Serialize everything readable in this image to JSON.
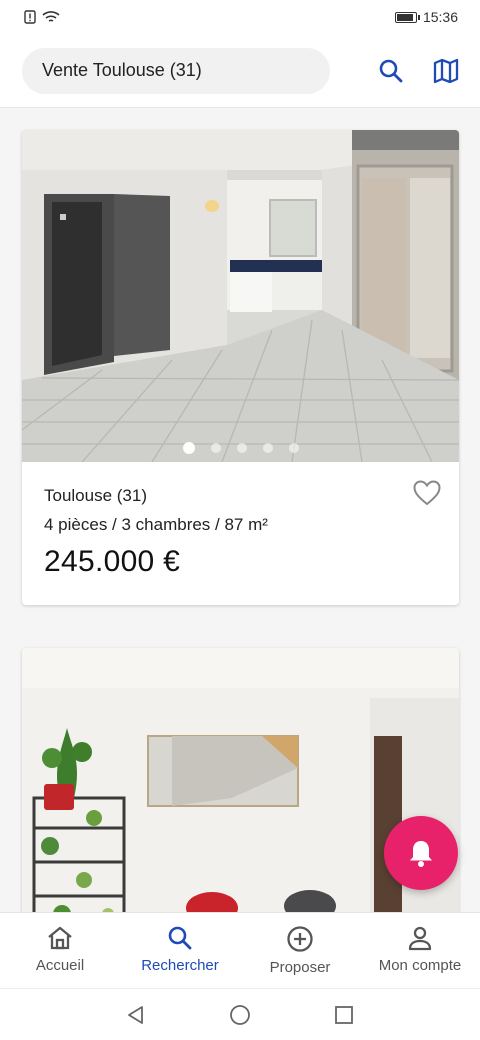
{
  "status": {
    "time": "15:36"
  },
  "search": {
    "query": "Vente Toulouse (31)"
  },
  "listings": [
    {
      "city": "Toulouse (31)",
      "specs": "4 pièces / 3 chambres / 87 m²",
      "price": "245.000 €",
      "photo_count": 5,
      "active_photo": 1
    },
    {
      "photo": "apartment-dining-room"
    }
  ],
  "nav": {
    "items": [
      {
        "label": "Accueil",
        "icon": "home-icon"
      },
      {
        "label": "Rechercher",
        "icon": "search-icon"
      },
      {
        "label": "Proposer",
        "icon": "plus-circle-icon"
      },
      {
        "label": "Mon compte",
        "icon": "person-icon"
      }
    ],
    "active_index": 1
  },
  "colors": {
    "accent": "#1e4bb8",
    "fab": "#e8226a"
  }
}
